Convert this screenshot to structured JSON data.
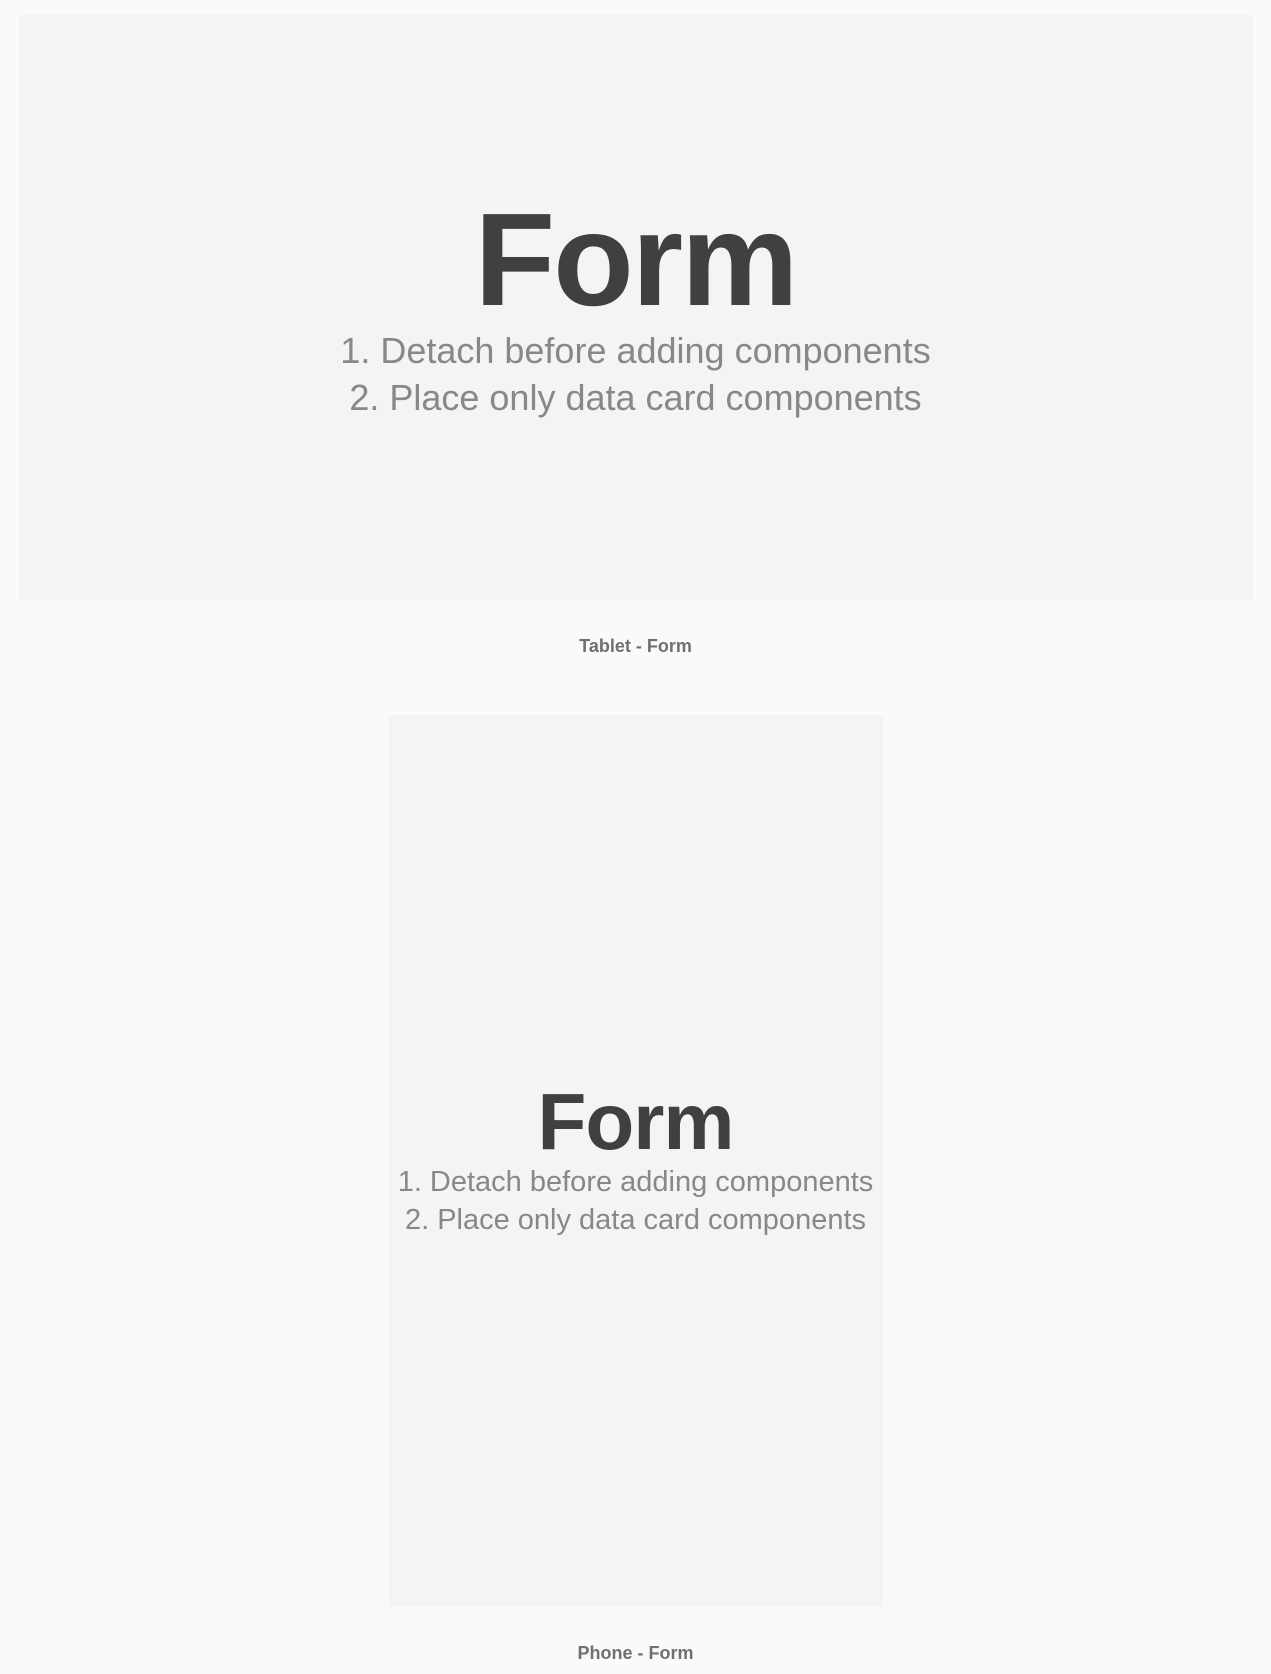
{
  "tablet": {
    "title": "Form",
    "instruction1": "1. Detach before adding components",
    "instruction2": "2. Place only data card components",
    "caption": "Tablet - Form"
  },
  "phone": {
    "title": "Form",
    "instruction1": "1. Detach before adding components",
    "instruction2": "2. Place only data card components",
    "caption": "Phone - Form"
  }
}
